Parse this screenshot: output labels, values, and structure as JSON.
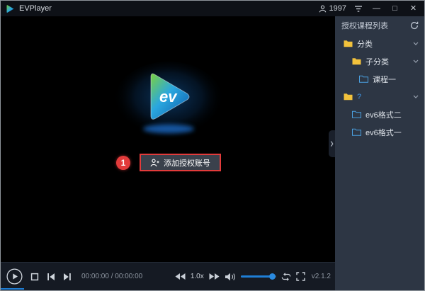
{
  "titlebar": {
    "title": "EVPlayer",
    "account": "1997",
    "minimize_icon": "—",
    "maximize_icon": "□",
    "close_icon": "✕"
  },
  "video": {
    "logo_text": "ev",
    "annotation": "1",
    "add_account_label": "添加授权账号"
  },
  "controls": {
    "time_display": "00:00:00 / 00:00:00",
    "speed": "1.0x",
    "version": "v2.1.2"
  },
  "sidebar": {
    "title": "授权课程列表",
    "collapse_icon": "❯",
    "items": [
      {
        "label": "分类"
      },
      {
        "label": "子分类"
      },
      {
        "label": "课程一"
      },
      {
        "label": "?"
      },
      {
        "label": "ev6格式二"
      },
      {
        "label": "ev6格式一"
      }
    ]
  },
  "colors": {
    "accent_blue": "#1f7fd6",
    "annotation_red": "#e23b3b",
    "folder_yellow": "#f2c23c",
    "folder_blue": "#4a9ede"
  }
}
